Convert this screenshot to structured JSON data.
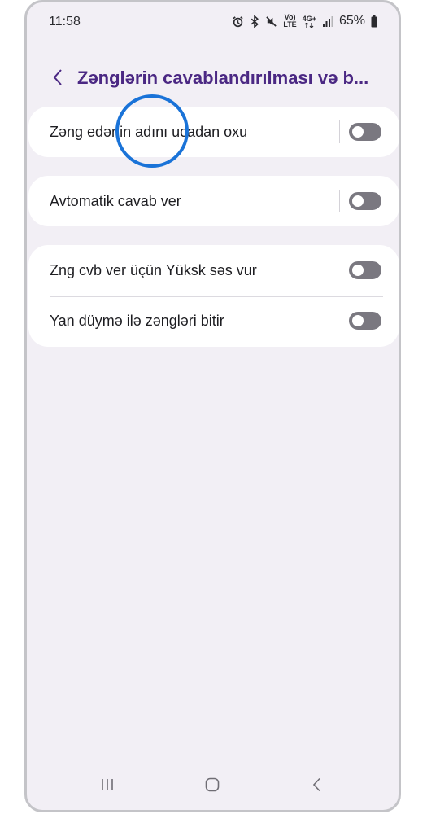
{
  "status_bar": {
    "time": "11:58",
    "icons": [
      "alarm-icon",
      "bluetooth-icon",
      "mute-icon",
      "volte-icon",
      "4g-icon",
      "signal-icon",
      "battery-icon"
    ],
    "volte_top": "Vo)",
    "volte_bottom": "LTE",
    "net_top": "4G+",
    "battery_percent": "65%"
  },
  "header": {
    "title": "Zənglərin cavablandırılması və b...",
    "back_icon": "chevron-left-icon"
  },
  "settings": {
    "read_caller_name": {
      "label": "Zəng edənin adını ucadan oxu",
      "enabled": false
    },
    "auto_answer": {
      "label": "Avtomatik cavab ver",
      "enabled": false
    },
    "volume_up_answer": {
      "label": "Zng cvb ver üçün Yüksk səs vur",
      "enabled": false
    },
    "side_key_end": {
      "label": "Yan düymə ilə zəngləri bitir",
      "enabled": false
    }
  },
  "navigation": {
    "recents_icon": "recents-icon",
    "home_icon": "home-icon",
    "back_icon": "back-icon"
  },
  "colors": {
    "background": "#f2eff5",
    "card": "#ffffff",
    "title": "#4b2883",
    "toggle_off": "#7a7880",
    "highlight": "#1a73d8"
  }
}
